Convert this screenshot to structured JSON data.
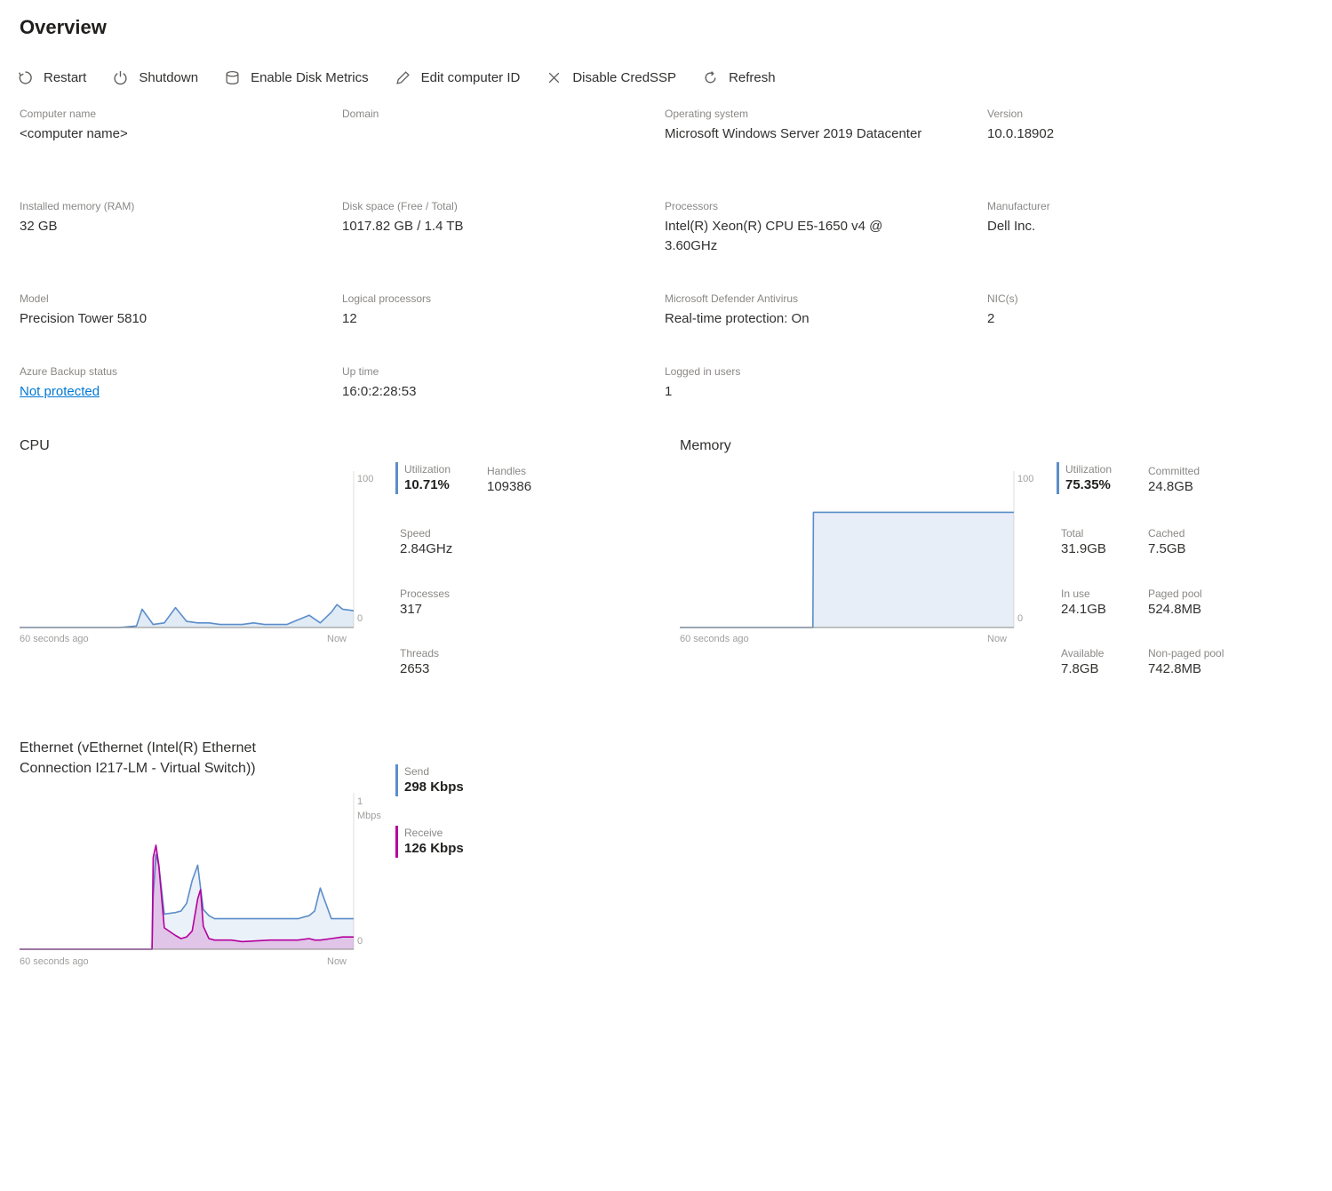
{
  "page": {
    "title": "Overview"
  },
  "toolbar": [
    {
      "label": "Restart",
      "icon": "restart-icon"
    },
    {
      "label": "Shutdown",
      "icon": "power-icon"
    },
    {
      "label": "Enable Disk Metrics",
      "icon": "disk-icon"
    },
    {
      "label": "Edit computer ID",
      "icon": "edit-icon"
    },
    {
      "label": "Disable CredSSP",
      "icon": "close-icon"
    },
    {
      "label": "Refresh",
      "icon": "refresh-icon"
    }
  ],
  "properties": {
    "computer_name": {
      "label": "Computer name",
      "value": "<computer name>"
    },
    "domain": {
      "label": "Domain",
      "value": ""
    },
    "os": {
      "label": "Operating system",
      "value": "Microsoft Windows Server 2019 Datacenter"
    },
    "version": {
      "label": "Version",
      "value": "10.0.18902"
    },
    "memory": {
      "label": "Installed memory (RAM)",
      "value": "32 GB"
    },
    "disk": {
      "label": "Disk space (Free / Total)",
      "value": "1017.82 GB / 1.4 TB"
    },
    "processors": {
      "label": "Processors",
      "value": "Intel(R) Xeon(R) CPU E5-1650 v4 @ 3.60GHz"
    },
    "manufacturer": {
      "label": "Manufacturer",
      "value": "Dell Inc."
    },
    "model": {
      "label": "Model",
      "value": "Precision Tower 5810"
    },
    "logical": {
      "label": "Logical processors",
      "value": "12"
    },
    "defender": {
      "label": "Microsoft Defender Antivirus",
      "value": "Real-time protection: On"
    },
    "nics": {
      "label": "NIC(s)",
      "value": "2"
    },
    "backup": {
      "label": "Azure Backup status",
      "value": "Not protected"
    },
    "uptime": {
      "label": "Up time",
      "value": "16:0:2:28:53"
    },
    "users": {
      "label": "Logged in users",
      "value": "1"
    }
  },
  "cpu": {
    "title": "CPU",
    "y_max_label": "100",
    "y_min_label": "0",
    "x_left_label": "60 seconds ago",
    "x_right_label": "Now",
    "stats": {
      "utilization": {
        "label": "Utilization",
        "value": "10.71%"
      },
      "handles": {
        "label": "Handles",
        "value": "109386"
      },
      "speed": {
        "label": "Speed",
        "value": "2.84GHz"
      },
      "processes": {
        "label": "Processes",
        "value": "317"
      },
      "threads": {
        "label": "Threads",
        "value": "2653"
      }
    }
  },
  "memory": {
    "title": "Memory",
    "y_max_label": "100",
    "y_min_label": "0",
    "x_left_label": "60 seconds ago",
    "x_right_label": "Now",
    "stats": {
      "utilization": {
        "label": "Utilization",
        "value": "75.35%"
      },
      "committed": {
        "label": "Committed",
        "value": "24.8GB"
      },
      "total": {
        "label": "Total",
        "value": "31.9GB"
      },
      "cached": {
        "label": "Cached",
        "value": "7.5GB"
      },
      "in_use": {
        "label": "In use",
        "value": "24.1GB"
      },
      "paged_pool": {
        "label": "Paged pool",
        "value": "524.8MB"
      },
      "available": {
        "label": "Available",
        "value": "7.8GB"
      },
      "nonpaged_pool": {
        "label": "Non-paged pool",
        "value": "742.8MB"
      }
    }
  },
  "ethernet": {
    "title": "Ethernet (vEthernet (Intel(R) Ethernet Connection I217-LM - Virtual Switch))",
    "y_max_value": "1",
    "y_max_unit": "Mbps",
    "y_min_label": "0",
    "x_left_label": "60 seconds ago",
    "x_right_label": "Now",
    "stats": {
      "send": {
        "label": "Send",
        "value": "298 Kbps"
      },
      "receive": {
        "label": "Receive",
        "value": "126 Kbps"
      }
    }
  },
  "colors": {
    "cpu": "#5b8ec9",
    "memory": "#5b8ec9",
    "send": "#5b8ec9",
    "receive": "#b4009e",
    "link": "#0078d4"
  },
  "chart_data": [
    {
      "type": "area",
      "title": "CPU",
      "x": [
        0,
        3,
        6,
        9,
        12,
        15,
        18,
        21,
        22,
        24,
        26,
        28,
        30,
        32,
        33,
        34,
        36,
        38,
        40,
        42,
        44,
        46,
        48,
        50,
        52,
        54,
        56,
        57,
        58,
        60
      ],
      "series": [
        {
          "values": [
            0,
            0,
            0,
            0,
            0,
            0,
            0,
            1,
            12,
            2,
            3,
            13,
            4,
            3,
            3,
            3,
            2,
            2,
            2,
            3,
            2,
            2,
            2,
            5,
            8,
            3,
            10,
            15,
            12,
            11
          ]
        }
      ],
      "ylim": [
        0,
        100
      ],
      "xlabel": "",
      "ylabel": ""
    },
    {
      "type": "area",
      "title": "Memory",
      "x": [
        0,
        5,
        10,
        15,
        20,
        23.9,
        24,
        30,
        40,
        50,
        60
      ],
      "series": [
        {
          "values": [
            0,
            0,
            0,
            0,
            0,
            0,
            75.35,
            75.35,
            75.35,
            75.35,
            75.35
          ]
        }
      ],
      "ylim": [
        0,
        100
      ],
      "xlabel": "",
      "ylabel": ""
    },
    {
      "type": "area",
      "title": "Ethernet (vEthernet (Intel(R) Ethernet Connection I217-LM - Virtual Switch))",
      "x": [
        0,
        5,
        10,
        15,
        20,
        23.8,
        24,
        24.5,
        25,
        26,
        28,
        29,
        30,
        31,
        32,
        32.5,
        33,
        34,
        35,
        36,
        38,
        40,
        45,
        50,
        52,
        53,
        54,
        56,
        58,
        60
      ],
      "series": [
        {
          "name": "Send",
          "values": [
            0,
            0,
            0,
            0,
            0,
            0,
            0.35,
            0.62,
            0.55,
            0.23,
            0.24,
            0.25,
            0.3,
            0.45,
            0.55,
            0.4,
            0.26,
            0.22,
            0.2,
            0.2,
            0.2,
            0.2,
            0.2,
            0.2,
            0.22,
            0.25,
            0.4,
            0.2,
            0.2,
            0.2
          ]
        },
        {
          "name": "Receive",
          "values": [
            0,
            0,
            0,
            0,
            0,
            0,
            0.6,
            0.68,
            0.55,
            0.14,
            0.09,
            0.07,
            0.08,
            0.12,
            0.33,
            0.39,
            0.15,
            0.07,
            0.06,
            0.06,
            0.06,
            0.05,
            0.06,
            0.06,
            0.07,
            0.06,
            0.06,
            0.07,
            0.08,
            0.08
          ]
        }
      ],
      "ylim": [
        0,
        1
      ],
      "xlabel": "",
      "ylabel": ""
    }
  ]
}
